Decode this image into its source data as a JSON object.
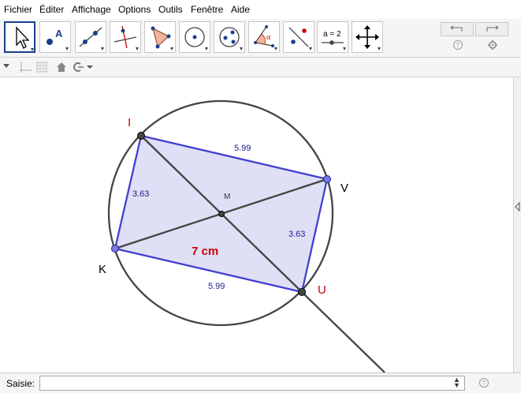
{
  "menu": [
    "Fichier",
    "Éditer",
    "Affichage",
    "Options",
    "Outils",
    "Fenêtre",
    "Aide"
  ],
  "tools": [
    {
      "name": "move-tool-icon"
    },
    {
      "name": "point-tool-icon"
    },
    {
      "name": "line-tool-icon"
    },
    {
      "name": "perpendicular-line-tool-icon"
    },
    {
      "name": "polygon-tool-icon"
    },
    {
      "name": "circle-tool-icon"
    },
    {
      "name": "circle-three-points-tool-icon"
    },
    {
      "name": "angle-tool-icon"
    },
    {
      "name": "reflect-tool-icon"
    },
    {
      "name": "slider-tool-icon",
      "label": "a = 2"
    },
    {
      "name": "move-view-tool-icon"
    }
  ],
  "input_bar": {
    "label": "Saisie:",
    "value": "",
    "placeholder": ""
  },
  "colors": {
    "accent": "#1a3e8c",
    "polygon_fill": "#dcdcf5",
    "polygon_edge": "#4040d0",
    "red_label": "#cc0000"
  },
  "figure": {
    "points": {
      "I": "I",
      "V": "V",
      "U": "U",
      "K": "K",
      "M": "M"
    },
    "segments": {
      "IV": "5.99",
      "VU": "3.63",
      "UK": "5.99",
      "KI": "3.63"
    },
    "area_text": "7 cm"
  }
}
